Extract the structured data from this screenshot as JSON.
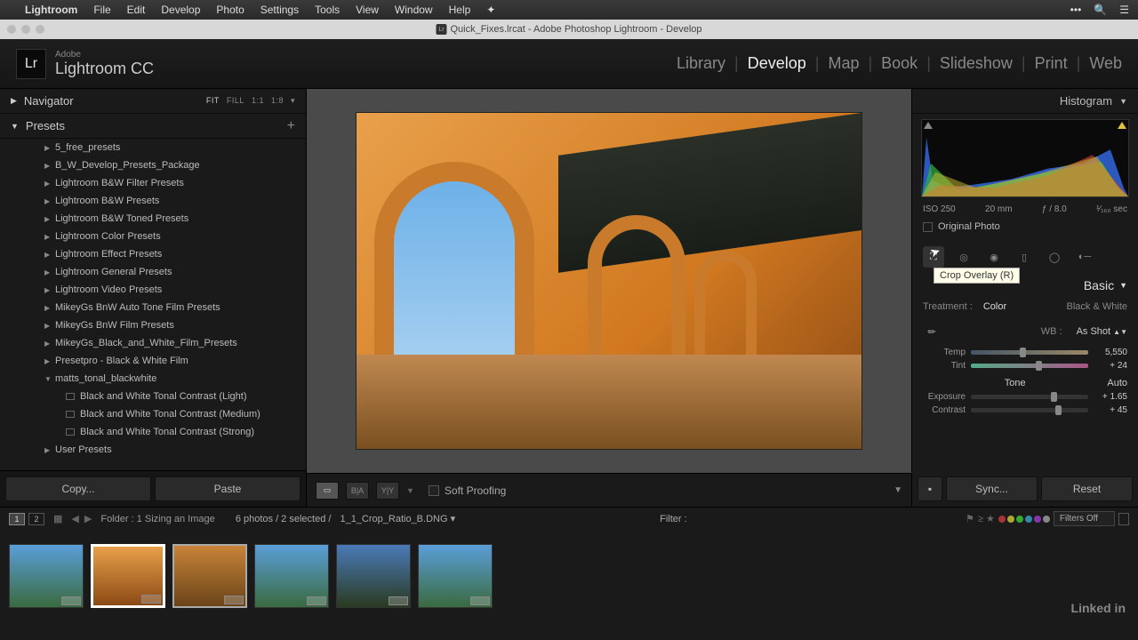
{
  "menubar": {
    "app": "Lightroom",
    "items": [
      "File",
      "Edit",
      "Develop",
      "Photo",
      "Settings",
      "Tools",
      "View",
      "Window",
      "Help"
    ]
  },
  "titlebar": {
    "title": "Quick_Fixes.lrcat - Adobe Photoshop Lightroom - Develop"
  },
  "header": {
    "vendor": "Adobe",
    "product": "Lightroom CC",
    "modules": [
      "Library",
      "Develop",
      "Map",
      "Book",
      "Slideshow",
      "Print",
      "Web"
    ],
    "active_module": "Develop"
  },
  "left": {
    "navigator": {
      "title": "Navigator",
      "opts": [
        "FIT",
        "FILL",
        "1:1",
        "1:8"
      ],
      "selected": "FIT"
    },
    "presets_title": "Presets",
    "presets": [
      "5_free_presets",
      "B_W_Develop_Presets_Package",
      "Lightroom B&W Filter Presets",
      "Lightroom B&W Presets",
      "Lightroom B&W Toned Presets",
      "Lightroom Color Presets",
      "Lightroom Effect Presets",
      "Lightroom General Presets",
      "Lightroom Video Presets",
      "MikeyGs BnW Auto Tone Film Presets",
      "MikeyGs BnW Film Presets",
      "MikeyGs_Black_and_White_Film_Presets",
      "Presetpro - Black & White Film"
    ],
    "preset_open": "matts_tonal_blackwhite",
    "preset_children": [
      "Black and White Tonal Contrast (Light)",
      "Black and White Tonal Contrast (Medium)",
      "Black and White Tonal Contrast (Strong)"
    ],
    "preset_last": "User Presets",
    "buttons": {
      "copy": "Copy...",
      "paste": "Paste"
    }
  },
  "center": {
    "soft_proofing": "Soft Proofing"
  },
  "right": {
    "histogram_title": "Histogram",
    "meta": {
      "iso": "ISO 250",
      "focal": "20 mm",
      "aperture": "ƒ / 8.0",
      "shutter": "¹⁄₁₆₀ sec"
    },
    "original_photo": "Original Photo",
    "tooltip": "Crop Overlay (R)",
    "basic_title": "Basic",
    "treatment": {
      "label": "Treatment :",
      "color": "Color",
      "bw": "Black & White"
    },
    "wb": {
      "label": "WB :",
      "value": "As Shot"
    },
    "sliders": {
      "temp": {
        "label": "Temp",
        "value": "5,550",
        "pos": 42
      },
      "tint": {
        "label": "Tint",
        "value": "+ 24",
        "pos": 55
      },
      "exposure": {
        "label": "Exposure",
        "value": "+ 1.65",
        "pos": 68
      },
      "contrast": {
        "label": "Contrast",
        "value": "+ 45",
        "pos": 72
      }
    },
    "tone": {
      "title": "Tone",
      "auto": "Auto"
    },
    "buttons": {
      "sync": "Sync...",
      "reset": "Reset"
    }
  },
  "infobar": {
    "path": "Folder : 1 Sizing an Image",
    "count": "6 photos / 2 selected /",
    "file": "1_1_Crop_Ratio_B.DNG",
    "filter_label": "Filter :",
    "filters_off": "Filters Off"
  },
  "footer": {
    "brand": "Linked in"
  }
}
